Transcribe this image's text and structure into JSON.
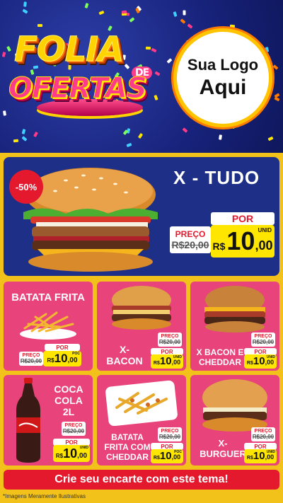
{
  "header": {
    "title_line1": "FOLIA",
    "title_de": "DE",
    "title_line2": "OFERTAS",
    "logo_line1": "Sua Logo",
    "logo_line2": "Aqui"
  },
  "featured": {
    "discount": "-50%",
    "name": "X - TUDO",
    "por": "POR",
    "preco": "PREÇO",
    "old_price": "R$20,00",
    "currency": "R$",
    "price_int": "10",
    "price_dec": ",00",
    "unit": "UNID"
  },
  "products": [
    {
      "name": "BATATA FRITA",
      "por": "POR",
      "preco": "PREÇO",
      "old_price": "R$20,00",
      "currency": "R$",
      "price_int": "10",
      "price_dec": ",00",
      "unit": "POC"
    },
    {
      "name": "X-BACON",
      "name_l1": "X-",
      "name_l2": "BACON",
      "por": "POR",
      "preco": "PREÇO",
      "old_price": "R$20,00",
      "currency": "R$",
      "price_int": "10",
      "price_dec": ",00",
      "unit": "UNID"
    },
    {
      "name_l1": "X BACON E",
      "name_l2": "CHEDDAR",
      "por": "POR",
      "preco": "PREÇO",
      "old_price": "R$20,00",
      "currency": "R$",
      "price_int": "10",
      "price_dec": ",00",
      "unit": "UNID"
    },
    {
      "name_l1": "COCA",
      "name_l2": "COLA",
      "name_l3": "2L",
      "por": "POR",
      "preco": "PREÇO",
      "old_price": "R$20,00",
      "currency": "R$",
      "price_int": "10",
      "price_dec": ",00",
      "unit": "UNID"
    },
    {
      "name_l1": "BATATA",
      "name_l2": "FRITA COM",
      "name_l3": "CHEDDAR",
      "por": "POR",
      "preco": "PREÇO",
      "old_price": "R$20,00",
      "currency": "R$",
      "price_int": "10",
      "price_dec": ",00",
      "unit": "POC"
    },
    {
      "name_l1": "X-",
      "name_l2": "BURGUER",
      "por": "POR",
      "preco": "PREÇO",
      "old_price": "R$20,00",
      "currency": "R$",
      "price_int": "10",
      "price_dec": ",00",
      "unit": "UNID"
    }
  ],
  "footer": {
    "banner": "Crie seu encarte com este tema!",
    "note": "*Imagens Meramente Ilustrativas"
  },
  "colors": {
    "pink": "#e8437a",
    "navy": "#1d2f86",
    "yellow": "#ffe600",
    "red": "#e5192d",
    "frame": "#f3c21a"
  }
}
